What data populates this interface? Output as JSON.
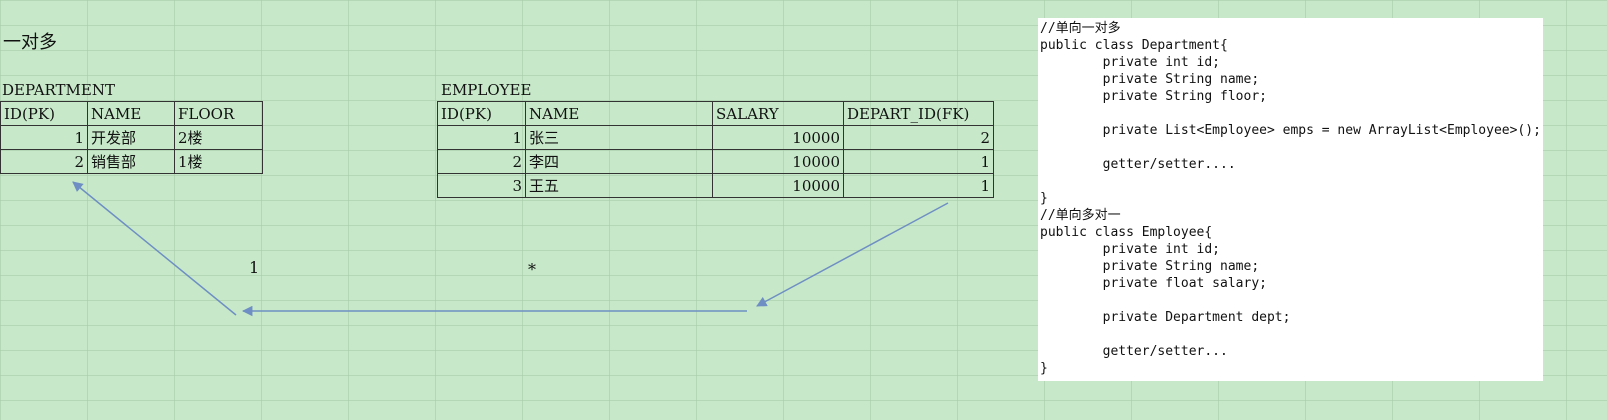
{
  "title": "一对多",
  "department": {
    "caption": "DEPARTMENT",
    "headers": [
      "ID(PK)",
      "NAME",
      "FLOOR"
    ],
    "rows": [
      [
        "1",
        "开发部",
        "2楼"
      ],
      [
        "2",
        "销售部",
        "1楼"
      ]
    ]
  },
  "employee": {
    "caption": "EMPLOYEE",
    "headers": [
      "ID(PK)",
      "NAME",
      "SALARY",
      "DEPART_ID(FK)"
    ],
    "rows": [
      [
        "1",
        "张三",
        "10000",
        "2"
      ],
      [
        "2",
        "李四",
        "10000",
        "1"
      ],
      [
        "3",
        "王五",
        "10000",
        "1"
      ]
    ]
  },
  "relation": {
    "one_label": "1",
    "many_label": "*",
    "arrow_color": "#6f8fc4"
  },
  "code_lines": [
    "//单向一对多",
    "public class Department{",
    "        private int id;",
    "        private String name;",
    "        private String floor;",
    "",
    "        private List<Employee> emps = new ArrayList<Employee>();",
    "",
    "        getter/setter....",
    "",
    "}",
    "//单向多对一",
    "public class Employee{",
    "        private int id;",
    "        private String name;",
    "        private float salary;",
    "",
    "        private Department dept;",
    "",
    "        getter/setter...",
    "}"
  ]
}
